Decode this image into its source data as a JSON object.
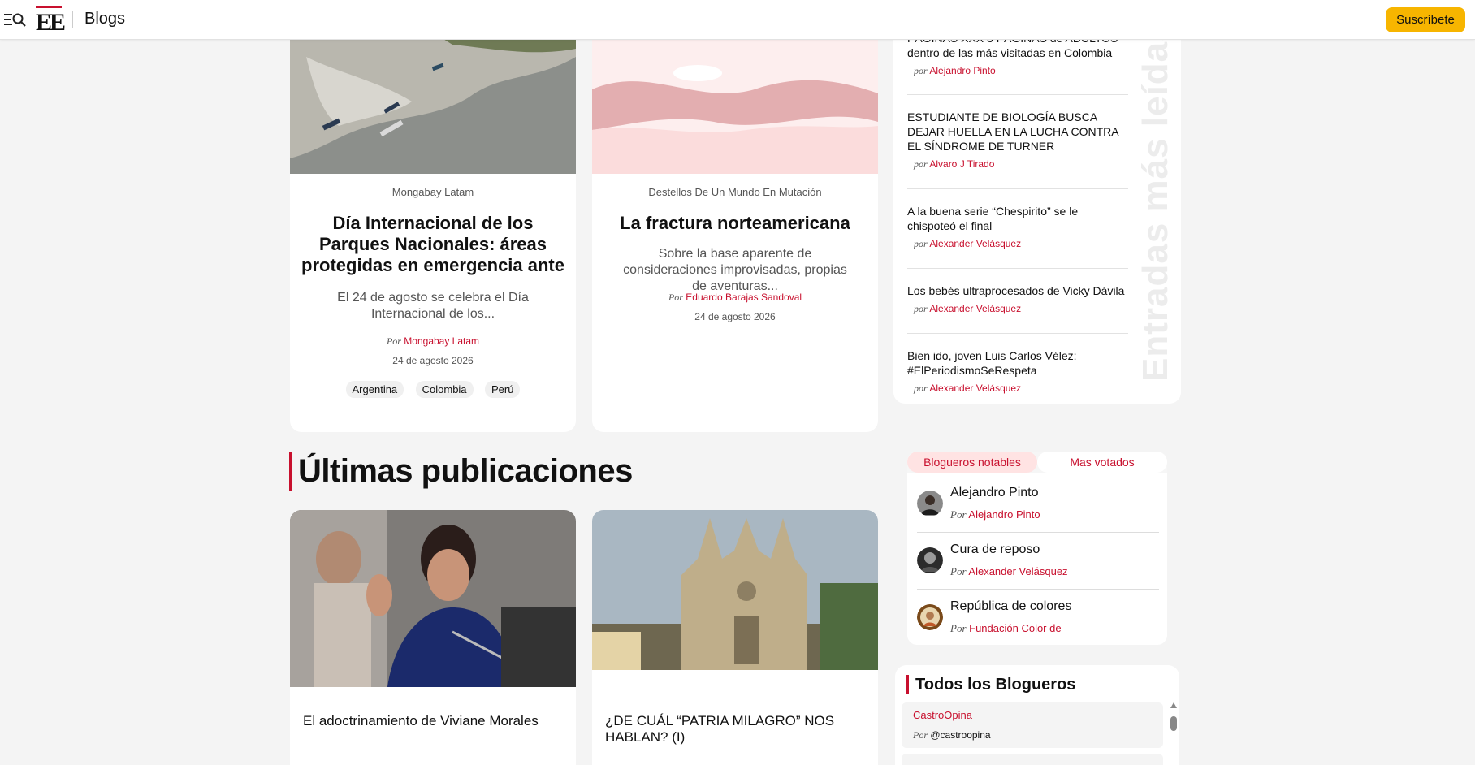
{
  "header": {
    "section": "Blogs",
    "logo_text": "EE",
    "subscribe": "Suscríbete"
  },
  "featured": [
    {
      "source": "Mongabay Latam",
      "title": "Día Internacional de los Parques Nacionales: áreas protegidas en emergencia ante",
      "desc": "El 24 de agosto se celebra el Día Internacional de los...",
      "by_prefix": "Por",
      "author": "Mongabay Latam",
      "date": "24 de agosto 2026",
      "tags": [
        "Argentina",
        "Colombia",
        "Perú"
      ]
    },
    {
      "source": "Destellos De Un Mundo En Mutación",
      "title": "La fractura norteamericana",
      "desc": "Sobre la base aparente de consideraciones improvisadas, propias de aventuras...",
      "by_prefix": "Por",
      "author": "Eduardo Barajas Sandoval",
      "date": "24 de agosto 2026"
    }
  ],
  "latest": {
    "heading": "Últimas publicaciones",
    "items": [
      {
        "title": "El adoctrinamiento de Viviane Morales"
      },
      {
        "title": "¿DE CUÁL “PATRIA MILAGRO” NOS HABLAN? (I)"
      }
    ]
  },
  "most_read": {
    "label": "Entradas más leídas",
    "items": [
      {
        "title": "PÁGINAS XXX o PÁGINAS de ADULTOS dentro de las más visitadas en Colombia",
        "title_top": "PÁGINAS XXX o PÁGINAS de ADULTOS",
        "title_rest": "dentro de las más visitadas en Colombia",
        "by_prefix": "por",
        "author": "Alejandro Pinto"
      },
      {
        "title": "ESTUDIANTE DE BIOLOGÍA BUSCA DEJAR HUELLA EN LA LUCHA CONTRA EL SÍNDROME DE TURNER",
        "by_prefix": "por",
        "author": "Alvaro J Tirado"
      },
      {
        "title": "A la buena serie “Chespirito” se le chispoteó el final",
        "by_prefix": "por",
        "author": "Alexander Velásquez"
      },
      {
        "title": "Los bebés ultraprocesados de Vicky Dávila",
        "by_prefix": "por",
        "author": "Alexander Velásquez"
      },
      {
        "title": "Bien ido, joven Luis Carlos Vélez: #ElPeriodismoSeRespeta",
        "by_prefix": "por",
        "author": "Alexander Velásquez"
      }
    ]
  },
  "bloggers_tabs": {
    "tab_notables": "Blogueros notables",
    "tab_votados": "Mas votados",
    "items": [
      {
        "name": "Alejandro Pinto",
        "by_prefix": "Por",
        "author": "Alejandro Pinto"
      },
      {
        "name": "Cura de reposo",
        "by_prefix": "Por",
        "author": "Alexander Velásquez"
      },
      {
        "name": "República de colores",
        "by_prefix": "Por",
        "author": "Fundación Color de"
      }
    ]
  },
  "all_bloggers": {
    "title": "Todos los Blogueros",
    "items": [
      {
        "name": "CastroOpina",
        "by_prefix": "Por",
        "handle": "@castroopina"
      }
    ]
  },
  "colors": {
    "accent_red": "#c8102e",
    "subscribe_yellow": "#f7b500",
    "tab_active_bg": "#ffe3e3"
  }
}
